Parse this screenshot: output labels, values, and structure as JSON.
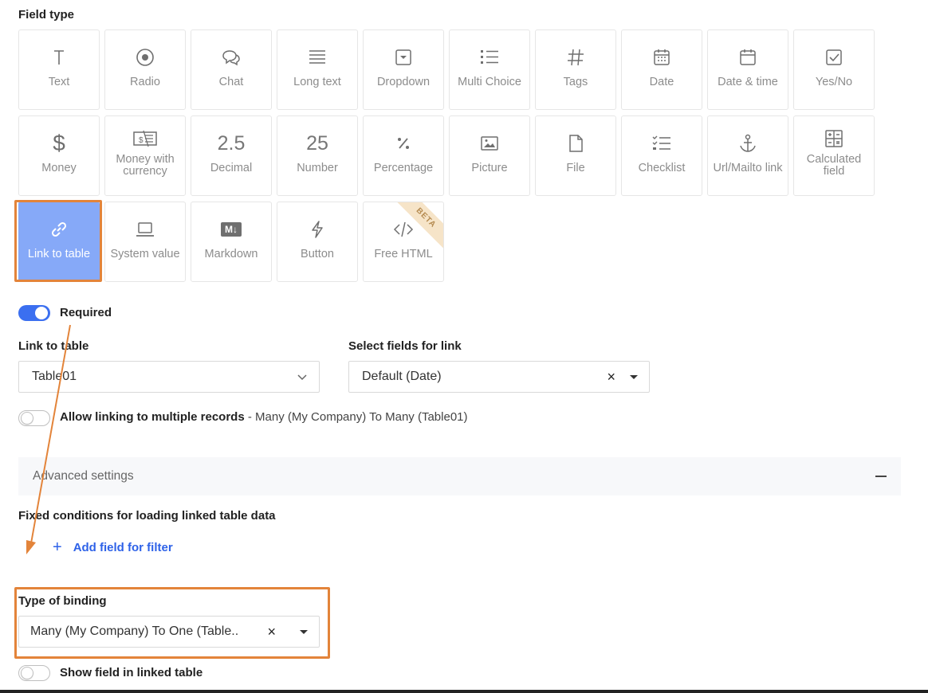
{
  "field_type": {
    "title": "Field type",
    "tiles": [
      {
        "label": "Text",
        "icon": "text-icon"
      },
      {
        "label": "Radio",
        "icon": "radio-icon"
      },
      {
        "label": "Chat",
        "icon": "chat-icon"
      },
      {
        "label": "Long text",
        "icon": "long-text-icon"
      },
      {
        "label": "Dropdown",
        "icon": "dropdown-icon"
      },
      {
        "label": "Multi Choice",
        "icon": "multi-choice-icon"
      },
      {
        "label": "Tags",
        "icon": "hash-icon"
      },
      {
        "label": "Date",
        "icon": "calendar-icon"
      },
      {
        "label": "Date & time",
        "icon": "calendar-blank-icon"
      },
      {
        "label": "Yes/No",
        "icon": "checkbox-icon"
      },
      {
        "label": "Money",
        "icon": "dollar-icon"
      },
      {
        "label": "Money with currency",
        "icon": "money-currency-icon"
      },
      {
        "label": "Decimal",
        "icon": "decimal-icon",
        "glyph": "2.5"
      },
      {
        "label": "Number",
        "icon": "number-icon",
        "glyph": "25"
      },
      {
        "label": "Percentage",
        "icon": "percent-icon"
      },
      {
        "label": "Picture",
        "icon": "picture-icon"
      },
      {
        "label": "File",
        "icon": "file-icon"
      },
      {
        "label": "Checklist",
        "icon": "checklist-icon"
      },
      {
        "label": "Url/Mailto link",
        "icon": "anchor-icon"
      },
      {
        "label": "Calculated field",
        "icon": "calculator-icon"
      },
      {
        "label": "Link to table",
        "icon": "link-icon",
        "selected": true
      },
      {
        "label": "System value",
        "icon": "laptop-icon"
      },
      {
        "label": "Markdown",
        "icon": "markdown-icon",
        "glyph": "M↓"
      },
      {
        "label": "Button",
        "icon": "lightning-icon"
      },
      {
        "label": "Free HTML",
        "icon": "code-icon",
        "badge": "BETA"
      }
    ]
  },
  "required": {
    "label": "Required",
    "on": true
  },
  "link_to_table": {
    "label": "Link to table",
    "value": "Table01"
  },
  "select_fields": {
    "label": "Select fields for link",
    "value": "Default (Date)",
    "clear": "×"
  },
  "allow_multiple": {
    "label": "Allow linking to multiple records",
    "desc": "- Many (My Company) To Many (Table01)",
    "on": false
  },
  "advanced": {
    "label": "Advanced settings"
  },
  "fixed_conditions": {
    "title": "Fixed conditions for loading linked table data",
    "add_label": "Add field for filter",
    "plus": "+"
  },
  "binding": {
    "label": "Type of binding",
    "value": "Many (My Company) To One (Table..",
    "clear": "×"
  },
  "show_field": {
    "label": "Show field in linked table",
    "on": false
  },
  "colors": {
    "accent": "#3b6ff0",
    "selected_tile": "#86a9f8",
    "highlight": "#e3843a",
    "link": "#2e62e8"
  }
}
